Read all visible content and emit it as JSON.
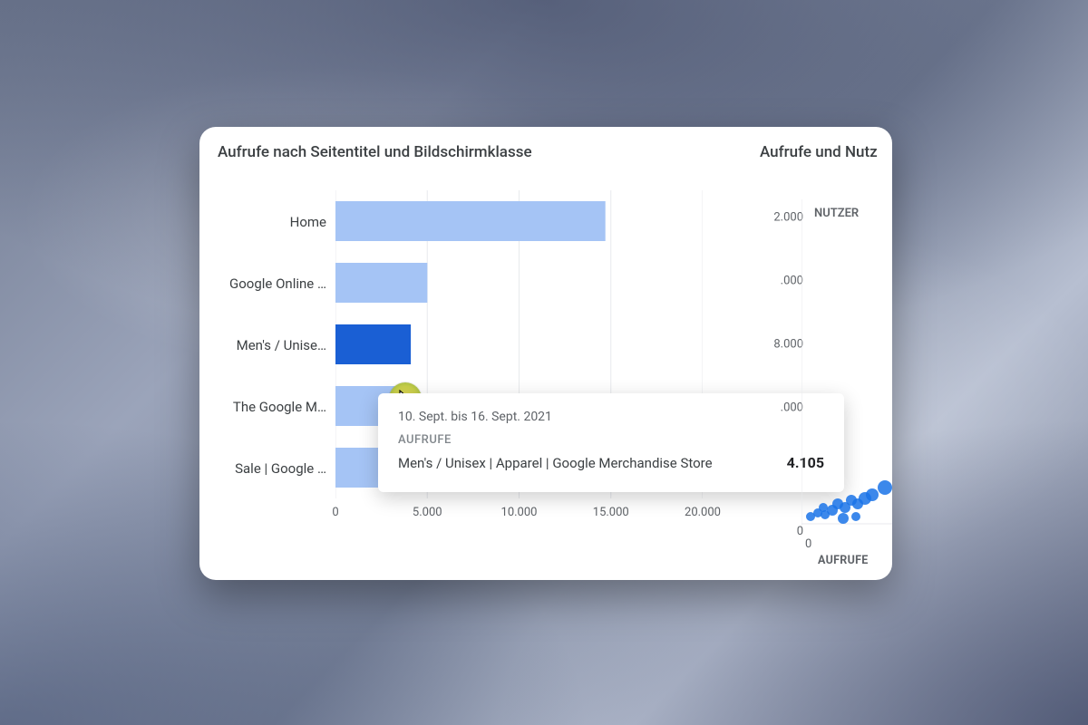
{
  "left_title": "Aufrufe nach Seitentitel und Bildschirmklasse",
  "right_title": "Aufrufe und Nutz",
  "nutzer_label": "NUTZER",
  "x_axis_right_label": "AUFRUFE",
  "x_ticks": [
    "0",
    "5.000",
    "10.000",
    "15.000",
    "20.000"
  ],
  "y_ticks_right": [
    "2.000",
    ".000",
    "8.000",
    ".000"
  ],
  "categories": [
    "Home",
    "Google Online …",
    "Men's / Unise…",
    "The Google M…",
    "Sale | Google …"
  ],
  "tooltip": {
    "date": "10. Sept. bis 16. Sept. 2021",
    "heading": "AUFRUFE",
    "name": "Men's / Unisex | Apparel | Google Merchandise Store",
    "value": "4.105"
  },
  "zero": "0",
  "chart_data": {
    "type": "bar",
    "orientation": "horizontal",
    "title": "Aufrufe nach Seitentitel und Bildschirmklasse",
    "xlabel": "Aufrufe",
    "xlim": [
      0,
      20000
    ],
    "x_ticks": [
      0,
      5000,
      10000,
      15000,
      20000
    ],
    "categories": [
      "Home",
      "Google Online …",
      "Men's / Unisex | Apparel | Google Merchandise Store",
      "The Google M…",
      "Sale | Google …"
    ],
    "values": [
      14700,
      5000,
      4105,
      3900,
      3500
    ],
    "highlighted_index": 2,
    "tooltip": {
      "date_range": "10. Sept. bis 16. Sept. 2021",
      "metric": "AUFRUFE",
      "label": "Men's / Unisex | Apparel | Google Merchandise Store",
      "value": 4105
    },
    "secondary": {
      "type": "scatter",
      "title": "Aufrufe und Nutzer",
      "xlabel": "AUFRUFE",
      "ylabel": "NUTZER",
      "y_ticks_visible": [
        2000,
        8000
      ],
      "points_note": "cluster near origin, partially cropped"
    }
  }
}
